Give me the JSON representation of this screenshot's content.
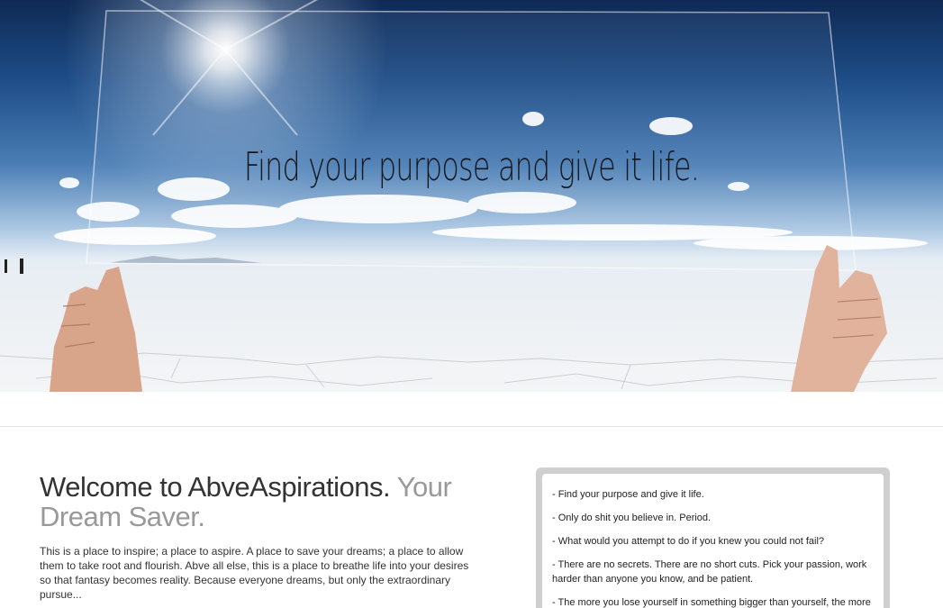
{
  "hero": {
    "headline": "Find your purpose and give it life."
  },
  "welcome": {
    "title_main": "Welcome to AbveAspirations.",
    "title_muted": "Your Dream Saver.",
    "body": "This is a place to inspire; a place to aspire. A place to save your dreams; a place to allow them to take root and flourish. Abve all else, this is a place to breathe life into your desires so that fantasy becomes reality. Because everyone dreams, but only the extraordinary pursue..."
  },
  "quotes": [
    "- Find your purpose and give it life.",
    "- Only do shit you believe in. Period.",
    "- What would you attempt to do if you knew you could not fail?",
    "- There are no secrets. There are no short cuts. Pick your passion, work harder than anyone you know, and be patient.",
    "- The more you lose yourself in something bigger than yourself, the more energy you will have."
  ],
  "colors": {
    "heading_text": "#333333",
    "muted_text": "#999999",
    "quote_frame": "#cfcfcf"
  }
}
